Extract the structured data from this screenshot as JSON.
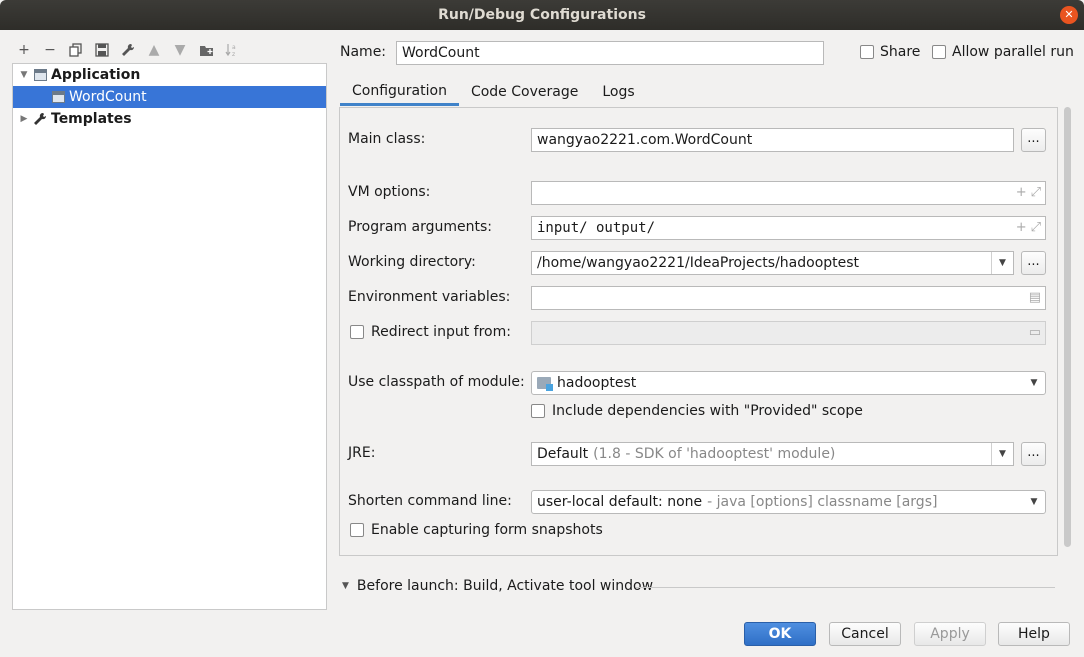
{
  "window": {
    "title": "Run/Debug Configurations"
  },
  "toolbar": {
    "buttons": [
      {
        "name": "add-icon",
        "glyph": "+"
      },
      {
        "name": "remove-icon",
        "glyph": "−"
      },
      {
        "name": "copy-icon",
        "glyph": "⧉"
      },
      {
        "name": "save-icon",
        "glyph": "▣"
      },
      {
        "name": "wrench-icon",
        "glyph": "🔧"
      },
      {
        "name": "move-up-icon",
        "glyph": "▲"
      },
      {
        "name": "move-down-icon",
        "glyph": "▼"
      },
      {
        "name": "new-folder-icon",
        "glyph": "▰"
      },
      {
        "name": "sort-icon",
        "glyph": "⇅"
      }
    ]
  },
  "tree": {
    "application": "Application",
    "wordcount": "WordCount",
    "templates": "Templates"
  },
  "header": {
    "name_label": "Name:",
    "name_value": "WordCount",
    "share_label": "Share",
    "parallel_label": "Allow parallel run"
  },
  "tabs": [
    "Configuration",
    "Code Coverage",
    "Logs"
  ],
  "form": {
    "main_class_label": "Main class:",
    "main_class_value": "wangyao2221.com.WordCount",
    "vm_options_label": "VM options:",
    "vm_options_value": "",
    "program_args_label": "Program arguments:",
    "program_args_value": "input/ output/",
    "working_dir_label": "Working directory:",
    "working_dir_value": "/home/wangyao2221/IdeaProjects/hadooptest",
    "env_vars_label": "Environment variables:",
    "env_vars_value": "",
    "redirect_label": "Redirect input from:",
    "classpath_label": "Use classpath of module:",
    "classpath_value": "hadooptest",
    "include_deps_label": "Include dependencies with \"Provided\" scope",
    "jre_label": "JRE:",
    "jre_value": "Default",
    "jre_hint": "(1.8 - SDK of 'hadooptest' module)",
    "shorten_label": "Shorten command line:",
    "shorten_value": "user-local default: none",
    "shorten_hint": "- java [options] classname [args]",
    "snapshots_label": "Enable capturing form snapshots",
    "dots": "..."
  },
  "before_launch": "Before launch: Build, Activate tool window",
  "buttons": {
    "ok": "OK",
    "cancel": "Cancel",
    "apply": "Apply",
    "help": "Help"
  },
  "colors": {
    "selection": "#3875d7",
    "primary": "#2f6fc6",
    "titlebar": "#2e2d29",
    "close": "#e95420"
  }
}
